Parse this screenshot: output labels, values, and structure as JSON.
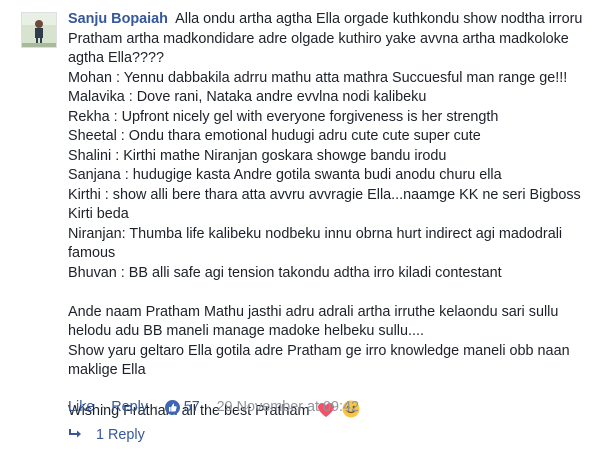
{
  "comment": {
    "author": "Sanju Bopaiah",
    "first_line": "Alla ondu artha agtha Ella orgade kuthkondu show nodtha irroru Pratham artha madkondidare adre olgade kuthiro yake avvna artha madkoloke agtha Ella????",
    "lines": [
      "Mohan : Yennu dabbakila adrru mathu atta mathra Succuesful man range ge!!!",
      "Malavika : Dove rani, Nataka andre evvlna nodi kalibeku",
      "Rekha : Upfront nicely gel with everyone forgiveness is her strength",
      "Sheetal : Ondu thara emotional hudugi adru cute cute super cute",
      "Shalini : Kirthi mathe Niranjan goskara showge bandu irodu",
      "Sanjana : hudugige kasta Andre gotila swanta budi anodu churu ella",
      "Kirthi : show alli bere thara atta avvru avvragie Ella...naamge KK ne seri Bigboss Kirti beda",
      "Niranjan: Thumba life kalibeku nodbeku innu obrna hurt indirect agi madodrali famous",
      "Bhuvan : BB alli safe agi tension takondu adtha irro kiladi contestant"
    ],
    "paragraph2": "Ande naam Pratham Mathu jasthi adru adrali artha irruthe kelaondu sari sullu helodu adu BB maneli manage madoke helbeku sullu....",
    "paragraph3": "Show yaru geltaro Ella gotila adre Pratham ge irro knowledge maneli obb naan maklige Ella",
    "wish": "Wishing Pratham all the best Pratham"
  },
  "actions": {
    "like": "Like",
    "dot": "·",
    "reply": "Reply",
    "like_count": "57",
    "date": "29 November at 09:42"
  },
  "replies": {
    "label": "1 Reply"
  },
  "icons": {
    "avatar": "avatar",
    "like_badge": "thumbs-up-icon",
    "heart": "heart-icon",
    "smile": "smile-icon",
    "reply_arrow": "reply-arrow-icon"
  },
  "colors": {
    "link": "#365899",
    "meta": "#90949c",
    "text": "#1d2129",
    "like_badge": "#4267b2",
    "heart": "#f25268",
    "smile": "#f7c744"
  }
}
